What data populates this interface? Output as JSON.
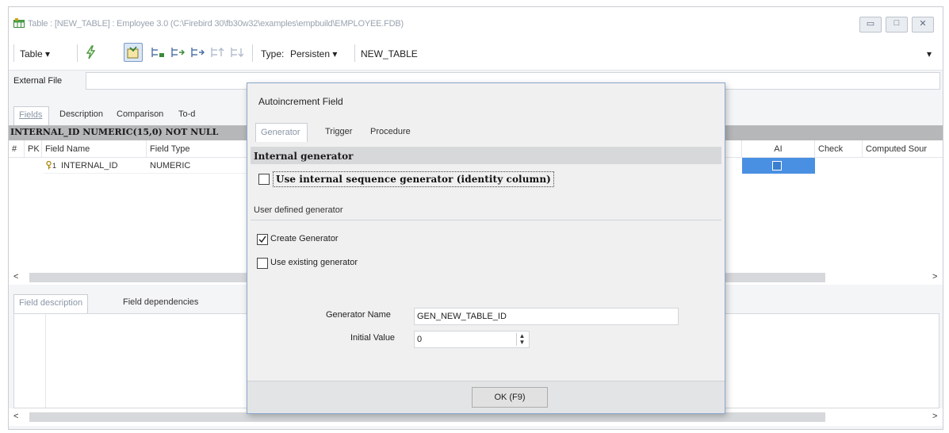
{
  "window": {
    "title": "Table : [NEW_TABLE] : Employee 3.0 (C:\\Firebird 30\\fb30w32\\examples\\empbuild\\EMPLOYEE.FDB)",
    "minimize_glyph": "▭",
    "maximize_glyph": "□",
    "close_glyph": "✕"
  },
  "toolbar": {
    "table_menu": "Table ▾",
    "type_label": "Type:",
    "type_value": "Persisten ▾",
    "table_name": "NEW_TABLE",
    "overflow_glyph": "▾"
  },
  "external_file": {
    "label": "External File",
    "value": ""
  },
  "tabs": [
    "Fields",
    "Description",
    "Comparison",
    "To-d"
  ],
  "pk_bar": "INTERNAL_ID NUMERIC(15,0) NOT NULL",
  "grid": {
    "headers": [
      "#",
      "PK",
      "Field Name",
      "Field Type",
      "AI",
      "Check",
      "Computed Sour"
    ],
    "rows": [
      {
        "pk": "1",
        "field_name": "INTERNAL_ID",
        "field_type": "NUMERIC"
      }
    ]
  },
  "scroll": {
    "left": "<",
    "right": ">"
  },
  "lower_tabs": [
    "Field description",
    "Field dependencies"
  ],
  "dialog": {
    "title": "Autoincrement Field",
    "tabs": [
      "Generator",
      "Trigger",
      "Procedure"
    ],
    "internal_section": "Internal generator",
    "use_internal_label": "Use internal sequence generator (identity column)",
    "use_internal_checked": false,
    "user_section": "User defined generator",
    "create_generator_label": "Create Generator",
    "create_generator_checked": true,
    "use_existing_label": "Use existing generator",
    "use_existing_checked": false,
    "generator_name_label": "Generator Name",
    "generator_name_value": "GEN_NEW_TABLE_ID",
    "initial_value_label": "Initial Value",
    "initial_value": "0",
    "ok_button": "OK (F9)"
  },
  "colors": {
    "selection": "#4a90e2",
    "pk_bar": "#b6b7b9",
    "dialog_border": "#8aa7cc"
  }
}
